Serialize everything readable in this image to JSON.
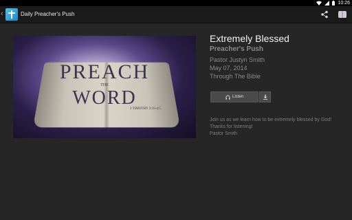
{
  "status_bar": {
    "time": "10:26"
  },
  "action_bar": {
    "title": "Daily Preacher's Push"
  },
  "artwork": {
    "line1": "PREACH",
    "line2": "THE",
    "line3": "WORD",
    "reference": "2 TIMOTHY 3:16-4:5"
  },
  "episode": {
    "title": "Extremely Blessed",
    "podcast": "Preacher's Push",
    "pastor": "Pastor Justyn Smith",
    "date": "May 07, 2014",
    "series": "Through The Bible"
  },
  "actions": {
    "listen_label": "Listen"
  },
  "description": {
    "line1": "Join us as we learn how to be extremely blessed by God!",
    "line2": "Thanks for listening!",
    "line3": "Pastor Smith"
  },
  "colors": {
    "background": "#262626",
    "action_bar": "#1a1a1a",
    "button": "#4a4a4a"
  }
}
